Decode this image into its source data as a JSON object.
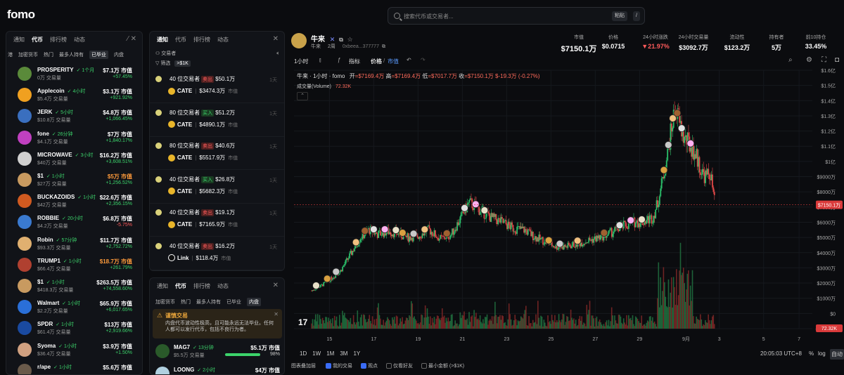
{
  "app": {
    "logo": "fomo"
  },
  "search": {
    "placeholder": "搜索代币或交易者...",
    "paste": "粘贴",
    "slash": "/"
  },
  "panel1": {
    "tabs": [
      "通知",
      "代币",
      "排行榜",
      "动态"
    ],
    "active_tab": 1,
    "subtabs": [
      "港",
      "加密货币",
      "热门",
      "最多人持有",
      "已毕业",
      "内盘"
    ],
    "selected_subtab": 4,
    "coins": [
      {
        "name": "PROSPERITY",
        "age": "1个月",
        "vol": "0万 交易量",
        "mc": "$7.1万 市值",
        "ch": "+57.45%",
        "color": "#5a8a3a",
        "up": true
      },
      {
        "name": "Applecoin",
        "age": "4小时",
        "vol": "$5.4万 交易量",
        "mc": "$3.1万 市值",
        "ch": "+921.92%",
        "color": "#f0a020",
        "up": true
      },
      {
        "name": "JERK",
        "age": "5小时",
        "vol": "$10.8万 交易量",
        "mc": "$4.8万 市值",
        "ch": "+1,066.45%",
        "color": "#3a6fbf",
        "up": true
      },
      {
        "name": "fone",
        "age": "26分钟",
        "vol": "$4.1万 交易量",
        "mc": "$7万 市值",
        "ch": "+1,840.17%",
        "color": "#c040c0",
        "up": true
      },
      {
        "name": "MICROWAVE",
        "age": "3小时",
        "vol": "$40万 交易量",
        "mc": "$16.2万 市值",
        "ch": "+3,608.51%",
        "color": "#d0d0d0",
        "up": true
      },
      {
        "name": "$1",
        "age": "1小时",
        "vol": "$27万 交易量",
        "mc": "$5万 市值",
        "ch": "+1,256.52%",
        "color": "#c89a60",
        "up": true,
        "mc_red": true
      },
      {
        "name": "BUCKAZOIDS",
        "age": "1小时",
        "vol": "$42万 交易量",
        "mc": "$22.6万 市值",
        "ch": "+2,356.15%",
        "color": "#d05a20",
        "up": true
      },
      {
        "name": "ROBBIE",
        "age": "20小时",
        "vol": "$4.2万 交易量",
        "mc": "$6.8万 市值",
        "ch": "-5.75%",
        "color": "#3a7ad0",
        "up": false
      },
      {
        "name": "Robin",
        "age": "57分钟",
        "vol": "$93.3万 交易量",
        "mc": "$11.7万 市值",
        "ch": "+2,752.72%",
        "color": "#e0b070",
        "up": true
      },
      {
        "name": "TRUMP1",
        "age": "1小时",
        "vol": "$66.4万 交易量",
        "mc": "$18.7万 市值",
        "ch": "+261.79%",
        "color": "#b04030",
        "up": true,
        "mc_red": true
      },
      {
        "name": "$1",
        "age": "1小时",
        "vol": "$418.3万 交易量",
        "mc": "$263.5万 市值",
        "ch": "+74,558.60%",
        "color": "#c89a60",
        "up": true
      },
      {
        "name": "Walmart",
        "age": "1小时",
        "vol": "$2.2万 交易量",
        "mc": "$65.9万 市值",
        "ch": "+6,017.65%",
        "color": "#2a6fd8",
        "up": true
      },
      {
        "name": "SPDR",
        "age": "1小时",
        "vol": "$61.4万 交易量",
        "mc": "$13万 市值",
        "ch": "+2,919.66%",
        "color": "#1a4aa0",
        "up": true
      },
      {
        "name": "Syoma",
        "age": "1小时",
        "vol": "$36.4万 交易量",
        "mc": "$3.9万 市值",
        "ch": "+1.50%",
        "color": "#d0a080",
        "up": true
      },
      {
        "name": "r/ape",
        "age": "1小时",
        "vol": "",
        "mc": "$5.6万 市值",
        "ch": "",
        "color": "#6a5a4a",
        "up": true
      }
    ]
  },
  "panel2": {
    "tabs": [
      "通知",
      "代币",
      "排行榜",
      "动态"
    ],
    "active_tab": 0,
    "section": "交易者",
    "filter": "筛选",
    "filter_chip": ">$1K",
    "trades": [
      {
        "who": "40 位交易者",
        "side": "卖出",
        "amt": "$50.1万",
        "token": "CATE",
        "mc": "$3474.3万",
        "time": "1天"
      },
      {
        "who": "80 位交易者",
        "side": "买入",
        "amt": "$51.2万",
        "token": "CATE",
        "mc": "$4890.1万",
        "time": "1天"
      },
      {
        "who": "80 位交易者",
        "side": "卖出",
        "amt": "$40.6万",
        "token": "CATE",
        "mc": "$5517.9万",
        "time": "1天"
      },
      {
        "who": "40 位交易者",
        "side": "买入",
        "amt": "$26.8万",
        "token": "CATE",
        "mc": "$5682.3万",
        "time": "1天"
      },
      {
        "who": "40 位交易者",
        "side": "卖出",
        "amt": "$19.1万",
        "token": "CATE",
        "mc": "$7165.9万",
        "time": "1天"
      },
      {
        "who": "40 位交易者",
        "side": "卖出",
        "amt": "$16.2万",
        "token": "Link",
        "mc": "$118.4万",
        "time": "1天"
      }
    ],
    "mc_word": "市值"
  },
  "panel3": {
    "tabs": [
      "通知",
      "代币",
      "排行榜",
      "动态"
    ],
    "active_tab": 1,
    "subtabs": [
      "加密货币",
      "热门",
      "最多人持有",
      "已毕业",
      "内盘"
    ],
    "selected_subtab": 4,
    "warn_title": "谨慎交易",
    "warn_body": "内盘代币波动性极高，且可能永远无法毕业。任何人都可以发行代币，包括不良行为者。",
    "coins": [
      {
        "name": "MAG7",
        "age": "13分钟",
        "vol": "$5.5万 交易量",
        "mc": "$5.1万 市值",
        "ch": "98%"
      },
      {
        "name": "LOONG",
        "age": "2小时",
        "vol": "",
        "mc": "$4万 市值",
        "ch": ""
      }
    ]
  },
  "token": {
    "name": "牛来",
    "symbol": "牛来",
    "age": "2周",
    "address": "0xbeea...377777",
    "stats": [
      {
        "label": "市值",
        "value": "$7150.1万"
      },
      {
        "label": "价格",
        "value": "$0.0715"
      },
      {
        "label": "24小时涨跌",
        "value": "▼21.97%",
        "color": "#ff5b5b"
      },
      {
        "label": "24小时交易量",
        "value": "$3092.7万"
      },
      {
        "label": "流动性",
        "value": "$123.2万"
      },
      {
        "label": "持有者",
        "value": "5万"
      },
      {
        "label": "前10持仓",
        "value": "33.45%"
      }
    ]
  },
  "toolbar": {
    "interval": "1小时",
    "indicators": "指标",
    "price": "价格",
    "mcap": "市值"
  },
  "legend": {
    "title": "牛来 · 1小时 · fomo",
    "o_label": "开",
    "o": "=$7169.4万",
    "h_label": "高",
    "h": "=$7169.4万",
    "l_label": "低",
    "l": "=$7017.7万",
    "c_label": "收",
    "c": "=$7150.1万",
    "chg": "$-19.3万 (-0.27%)",
    "vol_label": "成交量(Volume)",
    "vol_val": "72.32K"
  },
  "chart_data": {
    "type": "line",
    "x_tick_labels": [
      "15",
      "17",
      "19",
      "21",
      "23",
      "25",
      "27",
      "29",
      "9月",
      "3",
      "5",
      "7"
    ],
    "y_tick_labels": [
      "$1.6亿",
      "$1.5亿",
      "$1.4亿",
      "$1.3亿",
      "$1.2亿",
      "$1.1亿",
      "$1亿",
      "$9000万",
      "$8000万",
      "$7000万",
      "$6000万",
      "$5000万",
      "$4000万",
      "$3000万",
      "$2000万",
      "$1000万",
      "$0",
      "-$1000万"
    ],
    "ylim": [
      -10000000,
      160000000
    ],
    "last_price_label": "$7150.1万",
    "last_price": 71501000,
    "last_volume_label": "72.32K",
    "x": [
      14.2,
      14.6,
      15.0,
      15.5,
      16.0,
      16.4,
      16.8,
      17.2,
      17.6,
      18.0,
      18.5,
      19.0,
      19.5,
      20.0,
      20.5,
      20.9,
      21.3,
      21.8,
      22.3,
      22.8,
      23.3,
      23.8,
      24.3,
      24.8,
      25.2,
      25.7,
      26.2,
      26.7,
      27.2,
      27.7,
      28.2,
      28.7,
      29.1,
      29.4,
      29.6,
      29.8,
      30.0,
      30.2,
      30.4,
      30.6,
      30.8,
      31.0,
      31.2,
      31.4,
      31.6,
      31.8,
      32.0,
      32.2,
      32.4
    ],
    "y": [
      15000000,
      18000000,
      22000000,
      28000000,
      40000000,
      50000000,
      55000000,
      52000000,
      54000000,
      53000000,
      50000000,
      51000000,
      55000000,
      49000000,
      52000000,
      62000000,
      73000000,
      68000000,
      63000000,
      60000000,
      56000000,
      55000000,
      50000000,
      47000000,
      44000000,
      44000000,
      46000000,
      48000000,
      50000000,
      53000000,
      57000000,
      60000000,
      60000000,
      62000000,
      63000000,
      72000000,
      85000000,
      100000000,
      118000000,
      135000000,
      125000000,
      115000000,
      112000000,
      108000000,
      102000000,
      93000000,
      90000000,
      92000000,
      71501000
    ],
    "volume_scale_note": ""
  },
  "bottom": {
    "ranges": [
      "1D",
      "1W",
      "1M",
      "3M",
      "1Y"
    ],
    "time": "20:05:03 UTC+8",
    "pct": "%",
    "log": "log",
    "auto": "自动",
    "layers_label": "图表叠加层",
    "layers": [
      {
        "label": "我的交易",
        "on": true
      },
      {
        "label": "观点",
        "on": true
      },
      {
        "label": "仅看好友",
        "on": false
      },
      {
        "label": "最小金额 (>$1K)",
        "on": false
      }
    ]
  }
}
